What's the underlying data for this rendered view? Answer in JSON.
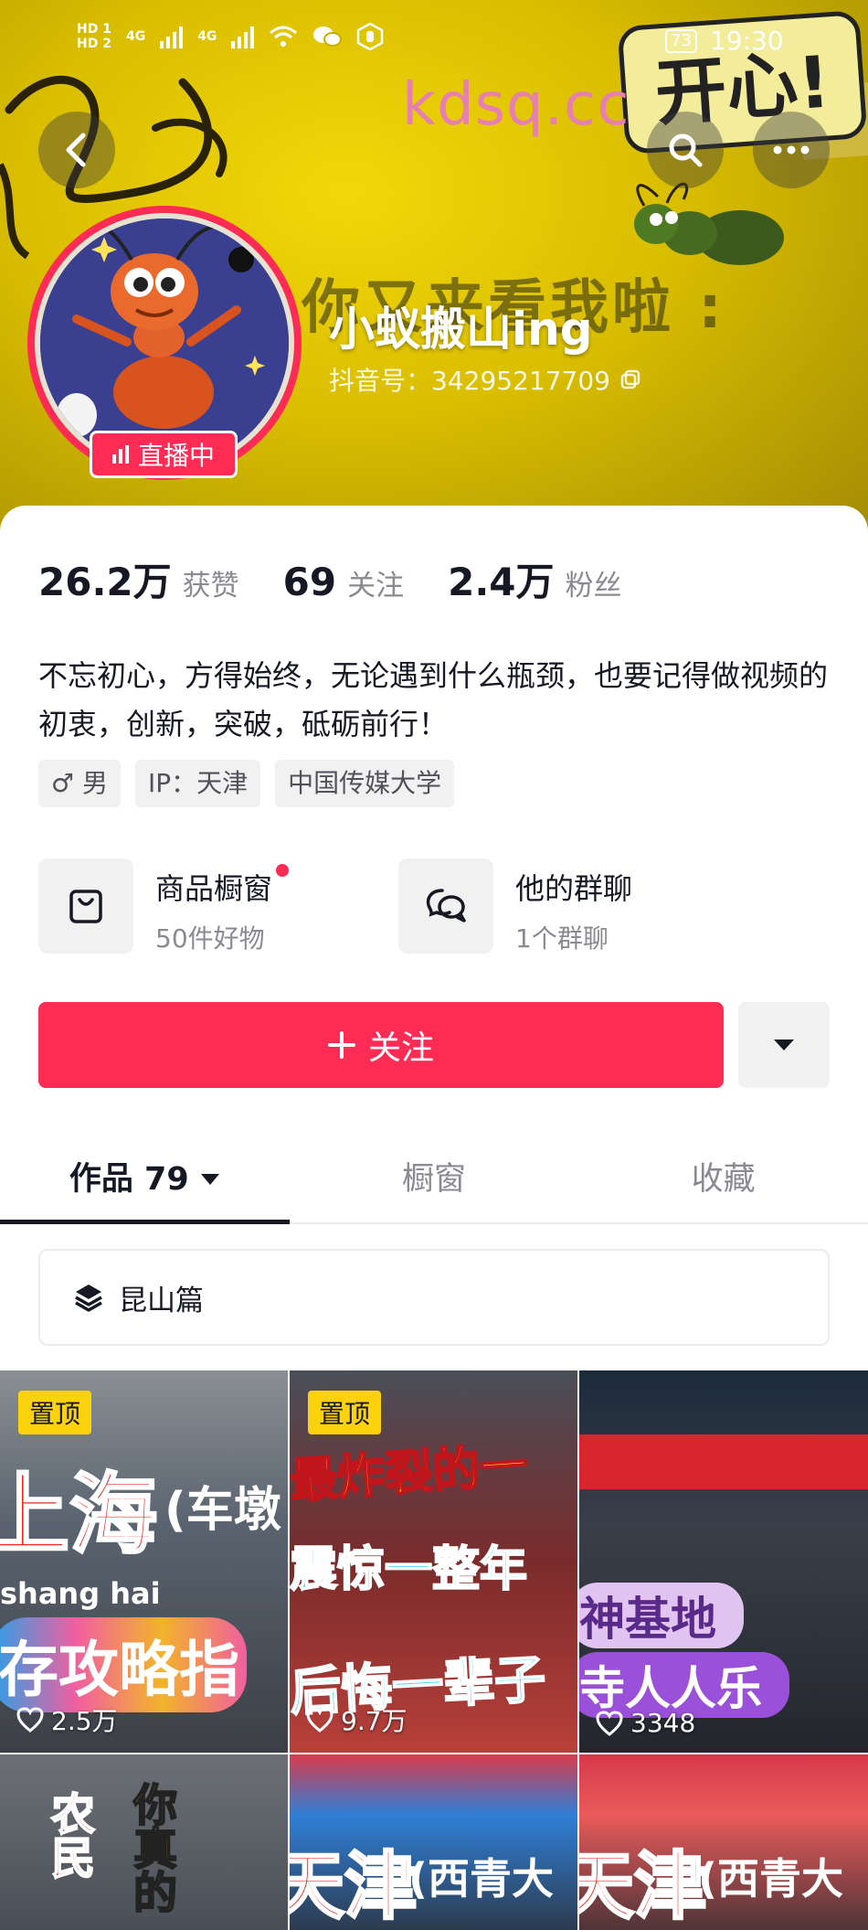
{
  "status_bar": {
    "sim1": "HD 1",
    "sim2": "HD 2",
    "net1": "4G",
    "net2": "4G",
    "battery": "73",
    "time": "19:30"
  },
  "banner": {
    "background_text": "你又来看我啦 :",
    "watermark": "kdsq.cc",
    "sticker_text": "开心!",
    "colors": {
      "accent": "#fe2c55",
      "banner": "#e0c400"
    }
  },
  "profile": {
    "username": "小蚁搬山ing",
    "douyin_id": "抖音号：34295217709",
    "live_badge": "直播中",
    "stats": [
      {
        "value": "26.2万",
        "label": "获赞"
      },
      {
        "value": "69",
        "label": "关注"
      },
      {
        "value": "2.4万",
        "label": "粉丝"
      }
    ],
    "bio": "不忘初心，方得始终，无论遇到什么瓶颈，也要记得做视频的初衷，创新，突破，砥砺前行！",
    "tags": [
      {
        "icon": "male-icon",
        "text": "♂ 男"
      },
      {
        "text": "IP：天津"
      },
      {
        "text": "中国传媒大学"
      }
    ]
  },
  "shortcuts": [
    {
      "title": "商品橱窗",
      "subtitle": "50件好物",
      "icon": "bag-icon"
    },
    {
      "title": "他的群聊",
      "subtitle": "1个群聊",
      "icon": "chat-icon"
    }
  ],
  "follow": {
    "label": "关注"
  },
  "tabs": [
    {
      "label": "作品 79"
    },
    {
      "label": "橱窗"
    },
    {
      "label": "收藏"
    }
  ],
  "collection": {
    "label": "昆山篇"
  },
  "videos": [
    {
      "pinned": "置顶",
      "likes": "2.5万",
      "lines": [
        "上海",
        "(车墩",
        "shang hai",
        "存攻略指"
      ]
    },
    {
      "pinned": "置顶",
      "likes": "9.7万",
      "lines": [
        "最炸裂的一",
        "震惊一整年",
        "后悔一辈子"
      ]
    },
    {
      "likes": "3348",
      "lines": [
        "神基地",
        "寺人人乐"
      ]
    },
    {
      "lines": [
        "农民",
        "你真的"
      ]
    },
    {
      "lines": [
        "天津",
        "(西青大"
      ]
    },
    {
      "lines": [
        "天津",
        "(西青大"
      ]
    }
  ]
}
